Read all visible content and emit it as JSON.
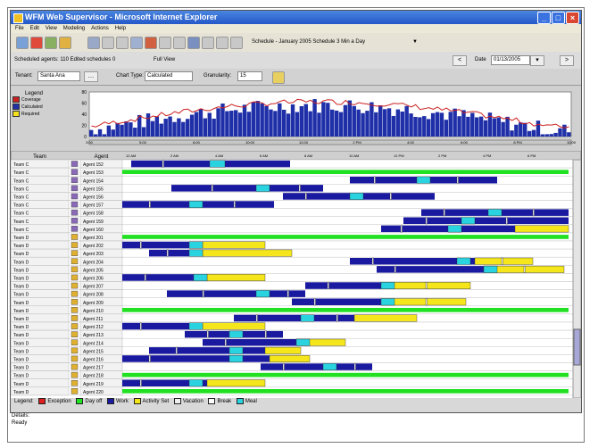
{
  "window": {
    "title": "WFM Web Supervisor - Microsoft Internet Explorer",
    "min": "_",
    "max": "□",
    "close": "×"
  },
  "menu": [
    "File",
    "Edit",
    "View",
    "Modeling",
    "Actions",
    "Help"
  ],
  "toolbar": {
    "schedule_label": "Schedule - January 2005 Schedule 3 Min a Day"
  },
  "filterbar": {
    "scheduled_agents": "Scheduled agents: 110 Edited schedules 0",
    "view_option": "Full View",
    "date_label": "Date",
    "date_value": "01/13/2005",
    "prev_btn": "<",
    "next_btn": ">"
  },
  "chartbar": {
    "tenant_label": "Tenant:",
    "tenant_value": "Santa Ana",
    "chart_type_label": "Chart Type:",
    "chart_type_value": "Calculated",
    "granularity_label": "Granularity:",
    "granularity_value": "15"
  },
  "histogram_legend": {
    "title": "Legend",
    "items": [
      {
        "label": "Coverage",
        "color": "#cc2020"
      },
      {
        "label": "Calculated",
        "color": "#1f2fa8"
      },
      {
        "label": "Required",
        "color": "#f3e21c"
      }
    ]
  },
  "histogram": {
    "y_ticks": [
      "80",
      "60",
      "40",
      "20",
      "0"
    ],
    "x_ticks": [
      "3:00",
      "5:00",
      "8:00",
      "10:00",
      "12:00",
      "2 PM",
      "4:00",
      "6:00",
      "8 PM",
      "10:00"
    ],
    "bar_color": "#1f2fa8",
    "line_color": "#cc2020"
  },
  "grid": {
    "col_team": "Team",
    "col_agent": "Agent",
    "time_ticks": [
      "12 AM",
      "2 AM",
      "4 AM",
      "6 AM",
      "8 AM",
      "10 AM",
      "12 PM",
      "2 PM",
      "4 PM",
      "6 PM"
    ],
    "rows": [
      {
        "team": "Team C",
        "agent": "Agent 152",
        "kind": "c"
      },
      {
        "team": "Team C",
        "agent": "Agent 153",
        "kind": "c"
      },
      {
        "team": "Team C",
        "agent": "Agent 154",
        "kind": "c"
      },
      {
        "team": "Team C",
        "agent": "Agent 155",
        "kind": "c"
      },
      {
        "team": "Team C",
        "agent": "Agent 156",
        "kind": "c"
      },
      {
        "team": "Team C",
        "agent": "Agent 157",
        "kind": "c"
      },
      {
        "team": "Team C",
        "agent": "Agent 158",
        "kind": "c"
      },
      {
        "team": "Team C",
        "agent": "Agent 159",
        "kind": "c"
      },
      {
        "team": "Team C",
        "agent": "Agent 160",
        "kind": "c"
      },
      {
        "team": "Team D",
        "agent": "Agent 201",
        "kind": "d"
      },
      {
        "team": "Team D",
        "agent": "Agent 202",
        "kind": "d"
      },
      {
        "team": "Team D",
        "agent": "Agent 203",
        "kind": "d"
      },
      {
        "team": "Team D",
        "agent": "Agent 204",
        "kind": "d"
      },
      {
        "team": "Team D",
        "agent": "Agent 205",
        "kind": "d"
      },
      {
        "team": "Team D",
        "agent": "Agent 206",
        "kind": "d"
      },
      {
        "team": "Team D",
        "agent": "Agent 207",
        "kind": "d"
      },
      {
        "team": "Team D",
        "agent": "Agent 208",
        "kind": "d"
      },
      {
        "team": "Team D",
        "agent": "Agent 209",
        "kind": "d"
      },
      {
        "team": "Team D",
        "agent": "Agent 210",
        "kind": "d"
      },
      {
        "team": "Team D",
        "agent": "Agent 211",
        "kind": "d"
      },
      {
        "team": "Team D",
        "agent": "Agent 212",
        "kind": "d"
      },
      {
        "team": "Team D",
        "agent": "Agent 213",
        "kind": "d"
      },
      {
        "team": "Team D",
        "agent": "Agent 214",
        "kind": "d"
      },
      {
        "team": "Team D",
        "agent": "Agent 215",
        "kind": "d"
      },
      {
        "team": "Team D",
        "agent": "Agent 216",
        "kind": "d"
      },
      {
        "team": "Team D",
        "agent": "Agent 217",
        "kind": "d"
      },
      {
        "team": "Team D",
        "agent": "Agent 218",
        "kind": "d"
      },
      {
        "team": "Team D",
        "agent": "Agent 219",
        "kind": "d"
      },
      {
        "team": "Team D",
        "agent": "Agent 220",
        "kind": "d"
      }
    ]
  },
  "legend": {
    "label": "Legend:",
    "items": [
      {
        "label": "Exception",
        "color": "#e02020"
      },
      {
        "label": "Day off",
        "color": "#22e022"
      },
      {
        "label": "Work",
        "color": "#1a1aa0"
      },
      {
        "label": "Activity Set",
        "color": "#f5e61c"
      },
      {
        "label": "Vacation",
        "color": "#eeeeee"
      },
      {
        "label": "Break",
        "color": "#ffffff"
      },
      {
        "label": "Meal",
        "color": "#29d4e0"
      }
    ]
  },
  "status": {
    "details": "Details:",
    "ready": "Ready"
  }
}
